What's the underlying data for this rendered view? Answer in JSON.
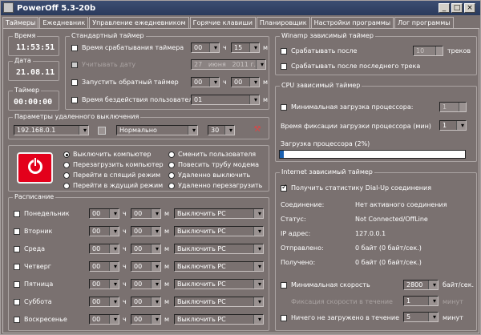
{
  "window": {
    "title": "PowerOff 5.3-20b"
  },
  "tabs": [
    "Таймеры",
    "Ежедневник",
    "Управление ежедневником",
    "Горячие клавиши",
    "Планировщик",
    "Настройки программы",
    "Лог программы"
  ],
  "clock": {
    "time_label": "Время",
    "time": "11:53:51",
    "date_label": "Дата",
    "date": "21.08.11",
    "timer_label": "Таймер",
    "timer": "00:00:00"
  },
  "std": {
    "legend": "Стандартный таймер",
    "trigger_time": "Время срабатывания таймера",
    "consider_date": "Учитывать дату",
    "countdown": "Запустить обратный таймер",
    "idle": "Время бездействия пользователя:",
    "h": "ч",
    "m": "м",
    "t1_h": "00",
    "t1_m": "15",
    "d_day": "27",
    "d_month": "июня",
    "d_year": "2011 г.",
    "t2_h": "00",
    "t2_m": "00",
    "idle_val": "01"
  },
  "remote": {
    "legend": "Параметры удаленного выключения",
    "ip": "192.168.0.1",
    "mode": "Нормально",
    "num": "30"
  },
  "actions": [
    "Выключить компьютер",
    "Перезагрузить компьютер",
    "Перейти в спящий режим",
    "Перейти в ждущий режим",
    "Сменить пользователя",
    "Повесить трубу модема",
    "Удаленно выключить",
    "Удаленно перезагрузить"
  ],
  "schedule": {
    "legend": "Расписание",
    "h": "ч",
    "m": "м",
    "days": [
      {
        "name": "Понедельник",
        "h": "00",
        "m": "00",
        "action": "Выключить PC"
      },
      {
        "name": "Вторник",
        "h": "00",
        "m": "00",
        "action": "Выключить PC"
      },
      {
        "name": "Среда",
        "h": "00",
        "m": "00",
        "action": "Выключить PC"
      },
      {
        "name": "Четверг",
        "h": "00",
        "m": "00",
        "action": "Выключить PC"
      },
      {
        "name": "Пятница",
        "h": "00",
        "m": "00",
        "action": "Выключить PC"
      },
      {
        "name": "Суббота",
        "h": "00",
        "m": "00",
        "action": "Выключить PC"
      },
      {
        "name": "Воскресенье",
        "h": "00",
        "m": "00",
        "action": "Выключить PC"
      }
    ]
  },
  "winamp": {
    "legend": "Winamp зависимый таймер",
    "after": "Срабатывать после",
    "tracks": "треков",
    "tracks_val": "10",
    "last": "Срабатывать после последнего трека"
  },
  "cpu": {
    "legend": "CPU зависимый таймер",
    "min_load": "Минимальная загрузка процессора:",
    "min_load_val": "1",
    "fix_time": "Время фиксации загрузки процессора (мин)",
    "fix_val": "1",
    "load": "Загрузка процессора (2%)",
    "load_frac": 0.02
  },
  "inet": {
    "legend": "Internet зависимый таймер",
    "stats": "Получить статистику Dial-Up соединения",
    "rows": [
      {
        "k": "Соединение:",
        "v": "Нет активного соединения"
      },
      {
        "k": "Статус:",
        "v": "Not Connected/OffLine"
      },
      {
        "k": "IP адрес:",
        "v": "127.0.0.1"
      },
      {
        "k": "Отправлено:",
        "v": "0 байт (0 байт/сек.)"
      },
      {
        "k": "Получено:",
        "v": "0 байт (0 байт/сек.)"
      }
    ],
    "min_speed": "Минимальная скорость",
    "speed_val": "2800",
    "speed_unit": "байт/сек.",
    "fix_speed": "Фиксация скорости в течение",
    "fix_speed_val": "1",
    "nothing": "Ничего не загружено в течение",
    "nothing_val": "5",
    "min": "минут"
  }
}
